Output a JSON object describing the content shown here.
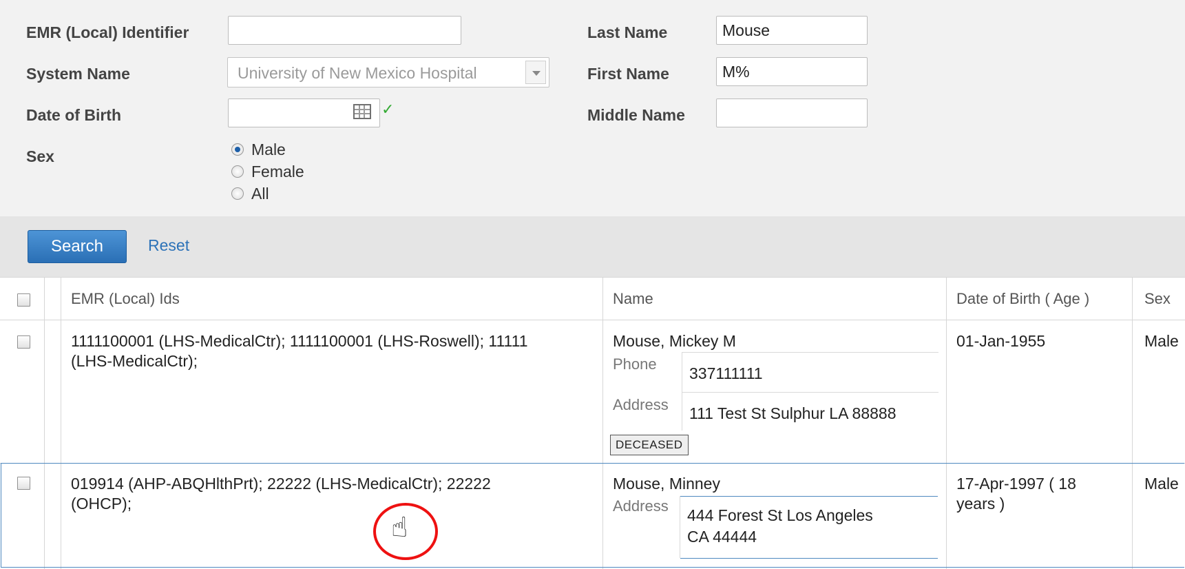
{
  "form": {
    "emr_id_label": "EMR (Local) Identifier",
    "emr_id_value": "",
    "system_name_label": "System Name",
    "system_name_value": "University of New Mexico Hospital",
    "dob_label": "Date of Birth",
    "dob_value": "",
    "sex_label": "Sex",
    "sex_options": [
      {
        "label": "Male",
        "checked": true
      },
      {
        "label": "Female",
        "checked": false
      },
      {
        "label": "All",
        "checked": false
      }
    ],
    "last_name_label": "Last Name",
    "last_name_value": "Mouse",
    "first_name_label": "First Name",
    "first_name_value": "M%",
    "middle_name_label": "Middle Name",
    "middle_name_value": ""
  },
  "actions": {
    "search_label": "Search",
    "reset_label": "Reset"
  },
  "table": {
    "headers": {
      "emr_ids": "EMR (Local) Ids",
      "name": "Name",
      "dob_age": "Date of Birth ( Age )",
      "sex": "Sex"
    },
    "rows": [
      {
        "emr_ids_line1": "1111100001 (LHS-MedicalCtr); 1111100001 (LHS-Roswell); 11111",
        "emr_ids_line2": "(LHS-MedicalCtr);",
        "name": "Mouse, Mickey M",
        "phone_label": "Phone",
        "phone": "337111111",
        "address_label": "Address",
        "address": "111 Test St Sulphur LA 88888",
        "badge": "DECEASED",
        "dob": "01-Jan-1955",
        "sex": "Male"
      },
      {
        "emr_ids_line1": "019914 (AHP-ABQHlthPrt); 22222 (LHS-MedicalCtr); 22222",
        "emr_ids_line2": "(OHCP);",
        "name": "Mouse, Minney",
        "address_label": "Address",
        "address_line1": "444 Forest St Los Angeles",
        "address_line2": "CA 44444",
        "dob_line1": "17-Apr-1997 ( 18",
        "dob_line2": "years )",
        "sex": "Male"
      }
    ]
  },
  "icons": {
    "calendar": "calendar-icon",
    "valid": "checkmark-icon",
    "dropdown": "chevron-down-icon",
    "cursor": "hand-pointer-icon"
  },
  "colors": {
    "accent": "#2a6fb5",
    "link": "#2c72b8",
    "valid": "#33aa33",
    "highlight_ring": "#ee1111",
    "selected_row_border": "#4d88bf"
  }
}
